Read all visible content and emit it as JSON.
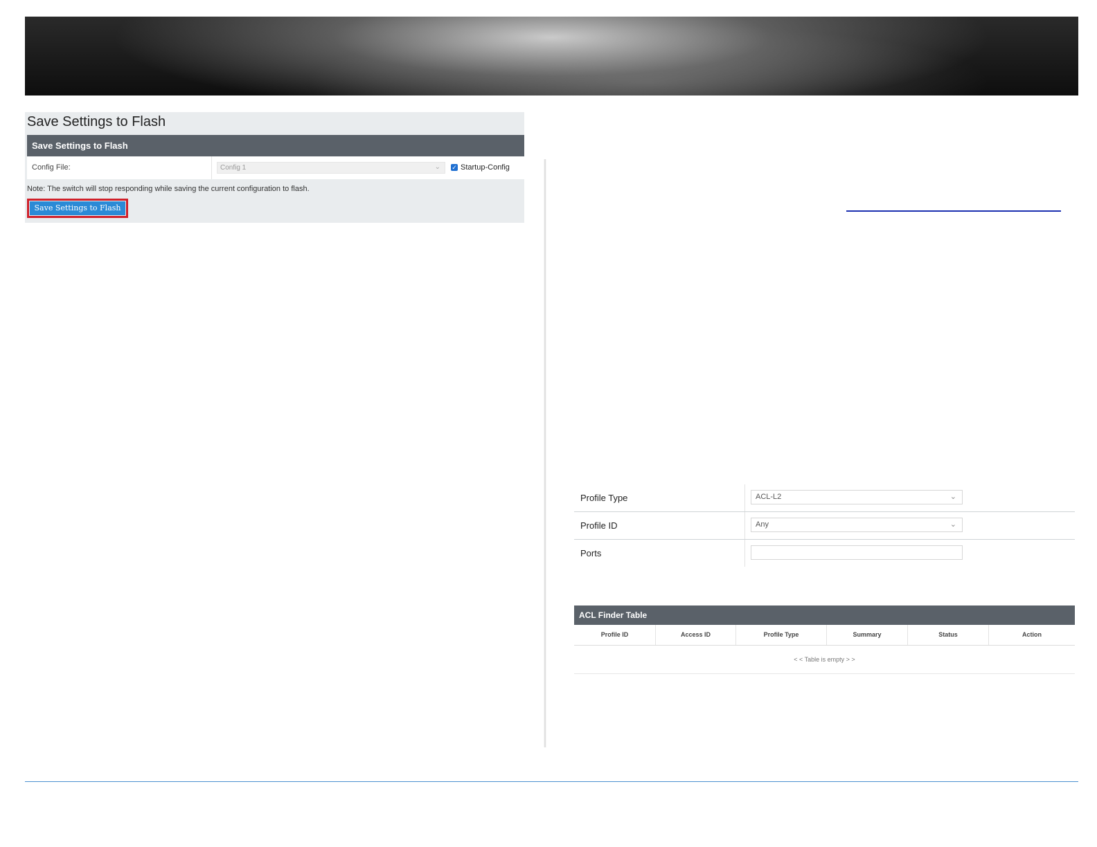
{
  "save_panel": {
    "page_title": "Save Settings to Flash",
    "header": "Save Settings to Flash",
    "config_file_label": "Config File:",
    "config_file_value": "Config 1",
    "startup_config_label": "Startup-Config",
    "startup_config_checked": true,
    "note": "Note: The switch will stop responding while saving the current configuration to flash.",
    "save_button": "Save Settings to Flash"
  },
  "profile_form": {
    "profile_type_label": "Profile Type",
    "profile_type_value": "ACL-L2",
    "profile_id_label": "Profile ID",
    "profile_id_value": "Any",
    "ports_label": "Ports",
    "ports_value": ""
  },
  "acl_table": {
    "title": "ACL Finder Table",
    "columns": [
      "Profile ID",
      "Access ID",
      "Profile Type",
      "Summary",
      "Status",
      "Action"
    ],
    "empty_text": "< < Table is empty > >"
  },
  "colors": {
    "header_bar": "#5a6169",
    "save_button": "#2b8ad6",
    "highlight_border": "#d0202a",
    "link_rule": "#1a2fb0"
  }
}
